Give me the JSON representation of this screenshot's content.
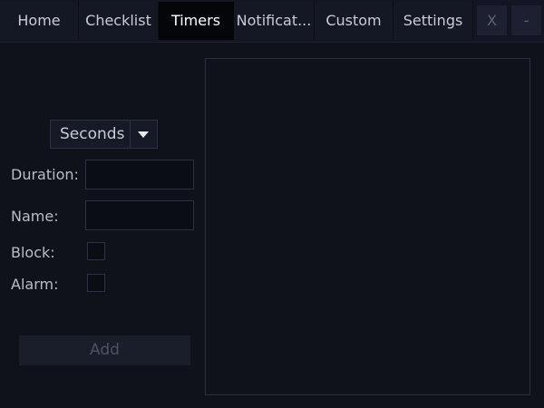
{
  "tabs": [
    {
      "label": "Home"
    },
    {
      "label": "Checklist"
    },
    {
      "label": "Timers"
    },
    {
      "label": "Notificat..."
    },
    {
      "label": "Custom"
    },
    {
      "label": "Settings"
    }
  ],
  "window_controls": {
    "close_label": "X",
    "minimize_label": "-"
  },
  "form": {
    "unit_select": {
      "value": "Seconds"
    },
    "duration_label": "Duration:",
    "duration_value": "",
    "name_label": "Name:",
    "name_value": "",
    "block_label": "Block:",
    "block_checked": false,
    "alarm_label": "Alarm:",
    "alarm_checked": false,
    "add_label": "Add"
  },
  "colors": {
    "background": "#10121b",
    "active_tab": "#05060a",
    "border": "#2b3042",
    "disabled_text": "#4c5163"
  }
}
